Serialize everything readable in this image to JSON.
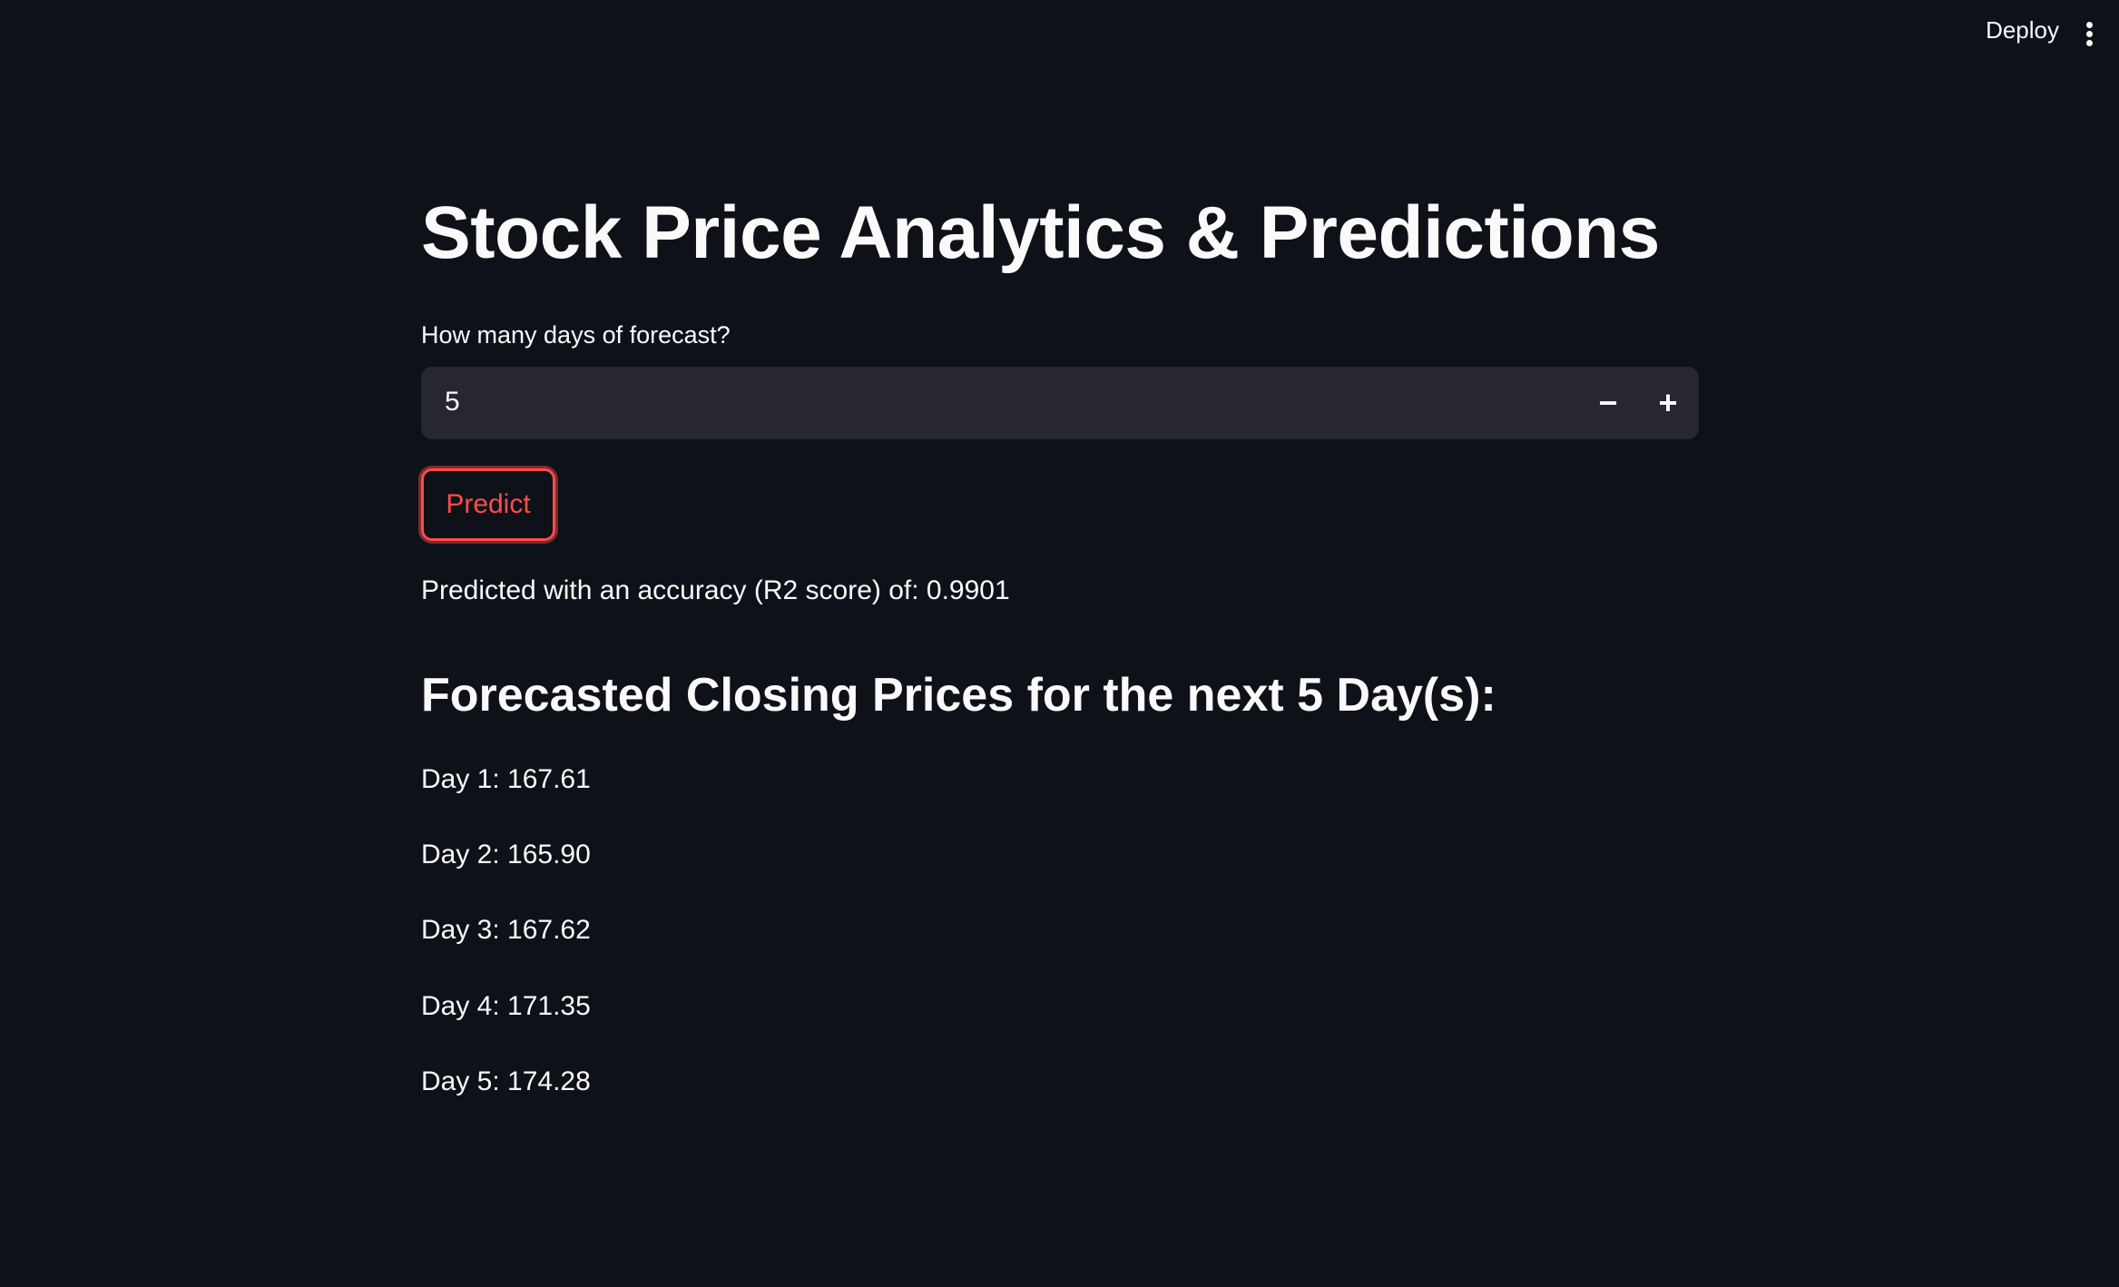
{
  "header": {
    "deploy_label": "Deploy",
    "menu_icon": "kebab-menu-icon"
  },
  "main": {
    "title": "Stock Price Analytics & Predictions",
    "forecast_input": {
      "label": "How many days of forecast?",
      "value": "5",
      "decrement_symbol": "−",
      "increment_symbol": "+"
    },
    "predict_label": "Predict",
    "accuracy_text": "Predicted with an accuracy (R2 score) of: 0.9901",
    "forecast_heading": "Forecasted Closing Prices for the next 5 Day(s):",
    "forecast_days": [
      "Day 1: 167.61",
      "Day 2: 165.90",
      "Day 3: 167.62",
      "Day 4: 171.35",
      "Day 5: 174.28"
    ]
  },
  "colors": {
    "background": "#0e1117",
    "input_background": "#262730",
    "accent": "#ff4b4b",
    "text": "#fafafa"
  }
}
